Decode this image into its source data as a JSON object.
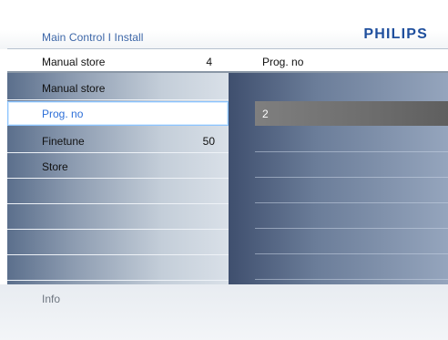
{
  "header": {
    "breadcrumb": "Main Control I Install",
    "brand": "PHILIPS"
  },
  "title_row": {
    "left_label": "Manual store",
    "left_value": "4",
    "right_label": "Prog. no"
  },
  "menu": {
    "items": [
      {
        "label": "Manual store",
        "value": ""
      },
      {
        "label": "Prog. no",
        "value": "",
        "selected": true
      },
      {
        "label": "Finetune",
        "value": "50"
      },
      {
        "label": "Store",
        "value": ""
      },
      {
        "label": "",
        "value": ""
      },
      {
        "label": "",
        "value": ""
      },
      {
        "label": "",
        "value": ""
      },
      {
        "label": "",
        "value": ""
      }
    ]
  },
  "submenu": {
    "selected_value": "2"
  },
  "info": {
    "label": "Info"
  },
  "colors": {
    "accent_blue": "#2d6fd8",
    "brand_blue": "#1f4f9d"
  }
}
